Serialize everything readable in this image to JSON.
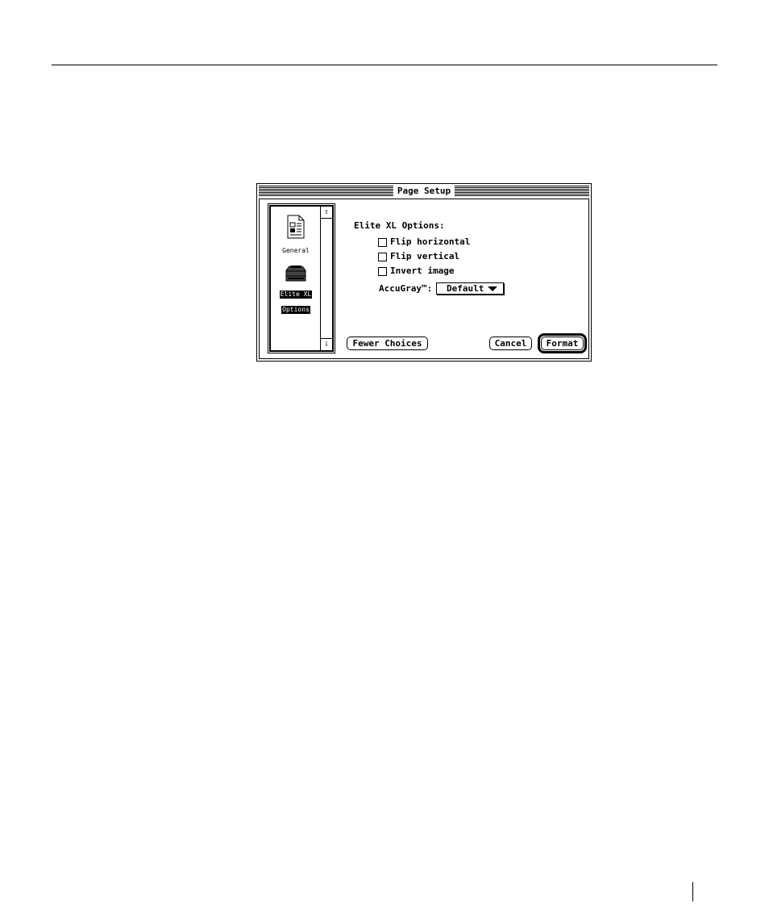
{
  "dialog": {
    "title": "Page Setup",
    "sidebar": {
      "items": [
        {
          "label": "General",
          "icon": "general-document-icon",
          "selected": false
        },
        {
          "label_line1": "Elite XL",
          "label_line2": "Options",
          "icon": "printer-icon",
          "selected": true
        }
      ],
      "scroll_up_glyph": "⇧",
      "scroll_down_glyph": "⇩"
    },
    "options": {
      "heading": "Elite XL Options:",
      "checkboxes": [
        {
          "label": "Flip horizontal",
          "checked": false
        },
        {
          "label": "Flip vertical",
          "checked": false
        },
        {
          "label": "Invert image",
          "checked": false
        }
      ],
      "accugray": {
        "label": "AccuGray™:",
        "selected_value": "Default"
      }
    },
    "buttons": {
      "fewer_choices": "Fewer Choices",
      "cancel": "Cancel",
      "format": "Format"
    }
  }
}
